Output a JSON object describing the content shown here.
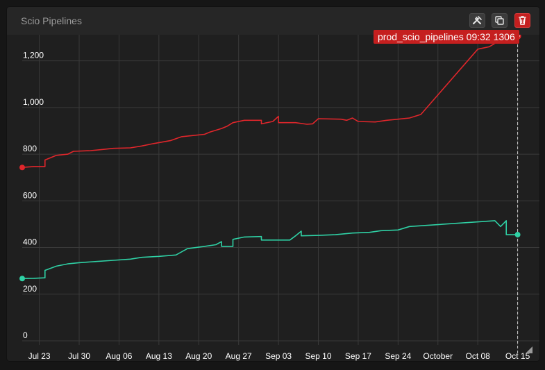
{
  "panel": {
    "title": "Scio Pipelines",
    "tools": [
      {
        "name": "settings-button",
        "icon": "tools-icon"
      },
      {
        "name": "duplicate-button",
        "icon": "copy-icon"
      },
      {
        "name": "delete-button",
        "icon": "trash-icon"
      }
    ]
  },
  "tooltip": {
    "series": "prod_scio_pipelines",
    "time": "09:32",
    "value": "1306"
  },
  "colors": {
    "background": "#1f1f1f",
    "grid": "#3a3a3a",
    "axis_text": "#ffffff",
    "series_red": "#e0262b",
    "series_teal": "#2fd1a5",
    "accent": "#c51f1f"
  },
  "chart_data": {
    "type": "line",
    "title": "",
    "xlabel": "",
    "ylabel": "",
    "ylim": [
      0,
      1300
    ],
    "y_ticks": [
      0,
      200,
      400,
      600,
      800,
      1000,
      1200
    ],
    "y_tick_labels": [
      "0",
      "200",
      "400",
      "600",
      "800",
      "1,000",
      "1,200"
    ],
    "x_ticks": [
      "2015-07-23",
      "2015-07-30",
      "2015-08-06",
      "2015-08-13",
      "2015-08-20",
      "2015-08-27",
      "2015-09-03",
      "2015-09-10",
      "2015-09-17",
      "2015-09-24",
      "2015-10-01",
      "2015-10-08",
      "2015-10-15"
    ],
    "x_tick_labels": [
      "Jul 23",
      "Jul 30",
      "Aug 06",
      "Aug 13",
      "Aug 20",
      "Aug 27",
      "Sep 03",
      "Sep 10",
      "Sep 17",
      "Sep 24",
      "October",
      "Oct 08",
      "Oct 15"
    ],
    "xlim": [
      "2015-07-20",
      "2015-10-17"
    ],
    "grid": true,
    "legend": "none",
    "series": [
      {
        "color": "#e0262b",
        "points": [
          [
            "2015-07-20",
            743
          ],
          [
            "2015-07-22",
            747
          ],
          [
            "2015-07-24",
            747
          ],
          [
            "2015-07-24",
            775
          ],
          [
            "2015-07-26",
            795
          ],
          [
            "2015-07-28",
            800
          ],
          [
            "2015-07-29",
            812
          ],
          [
            "2015-08-01",
            815
          ],
          [
            "2015-08-03",
            820
          ],
          [
            "2015-08-05",
            825
          ],
          [
            "2015-08-08",
            827
          ],
          [
            "2015-08-10",
            835
          ],
          [
            "2015-08-12",
            845
          ],
          [
            "2015-08-15",
            858
          ],
          [
            "2015-08-17",
            875
          ],
          [
            "2015-08-19",
            880
          ],
          [
            "2015-08-21",
            885
          ],
          [
            "2015-08-22",
            895
          ],
          [
            "2015-08-24",
            910
          ],
          [
            "2015-08-25",
            920
          ],
          [
            "2015-08-26",
            935
          ],
          [
            "2015-08-28",
            945
          ],
          [
            "2015-08-31",
            945
          ],
          [
            "2015-08-31",
            930
          ],
          [
            "2015-09-02",
            940
          ],
          [
            "2015-09-03",
            962
          ],
          [
            "2015-09-03",
            935
          ],
          [
            "2015-09-06",
            935
          ],
          [
            "2015-09-08",
            928
          ],
          [
            "2015-09-09",
            930
          ],
          [
            "2015-09-10",
            952
          ],
          [
            "2015-09-14",
            950
          ],
          [
            "2015-09-15",
            945
          ],
          [
            "2015-09-16",
            955
          ],
          [
            "2015-09-17",
            940
          ],
          [
            "2015-09-20",
            938
          ],
          [
            "2015-09-22",
            945
          ],
          [
            "2015-09-24",
            950
          ],
          [
            "2015-09-26",
            955
          ],
          [
            "2015-09-28",
            970
          ],
          [
            "2015-10-08",
            1250
          ],
          [
            "2015-10-10",
            1260
          ],
          [
            "2015-10-12",
            1290
          ],
          [
            "2015-10-13",
            1306
          ],
          [
            "2015-10-15",
            1306
          ]
        ]
      },
      {
        "color": "#2fd1a5",
        "points": [
          [
            "2015-07-20",
            267
          ],
          [
            "2015-07-22",
            268
          ],
          [
            "2015-07-24",
            270
          ],
          [
            "2015-07-24",
            302
          ],
          [
            "2015-07-26",
            320
          ],
          [
            "2015-07-28",
            330
          ],
          [
            "2015-07-30",
            335
          ],
          [
            "2015-08-02",
            340
          ],
          [
            "2015-08-05",
            345
          ],
          [
            "2015-08-08",
            350
          ],
          [
            "2015-08-10",
            358
          ],
          [
            "2015-08-13",
            362
          ],
          [
            "2015-08-16",
            368
          ],
          [
            "2015-08-18",
            395
          ],
          [
            "2015-08-21",
            405
          ],
          [
            "2015-08-23",
            412
          ],
          [
            "2015-08-24",
            425
          ],
          [
            "2015-08-24",
            405
          ],
          [
            "2015-08-26",
            405
          ],
          [
            "2015-08-26",
            435
          ],
          [
            "2015-08-28",
            445
          ],
          [
            "2015-08-31",
            447
          ],
          [
            "2015-08-31",
            432
          ],
          [
            "2015-09-05",
            432
          ],
          [
            "2015-09-06",
            450
          ],
          [
            "2015-09-07",
            470
          ],
          [
            "2015-09-07",
            450
          ],
          [
            "2015-09-10",
            452
          ],
          [
            "2015-09-13",
            455
          ],
          [
            "2015-09-16",
            462
          ],
          [
            "2015-09-19",
            465
          ],
          [
            "2015-09-21",
            472
          ],
          [
            "2015-09-24",
            475
          ],
          [
            "2015-09-26",
            490
          ],
          [
            "2015-10-11",
            515
          ],
          [
            "2015-10-12",
            490
          ],
          [
            "2015-10-13",
            515
          ],
          [
            "2015-10-13",
            455
          ],
          [
            "2015-10-15",
            455
          ]
        ]
      }
    ]
  }
}
